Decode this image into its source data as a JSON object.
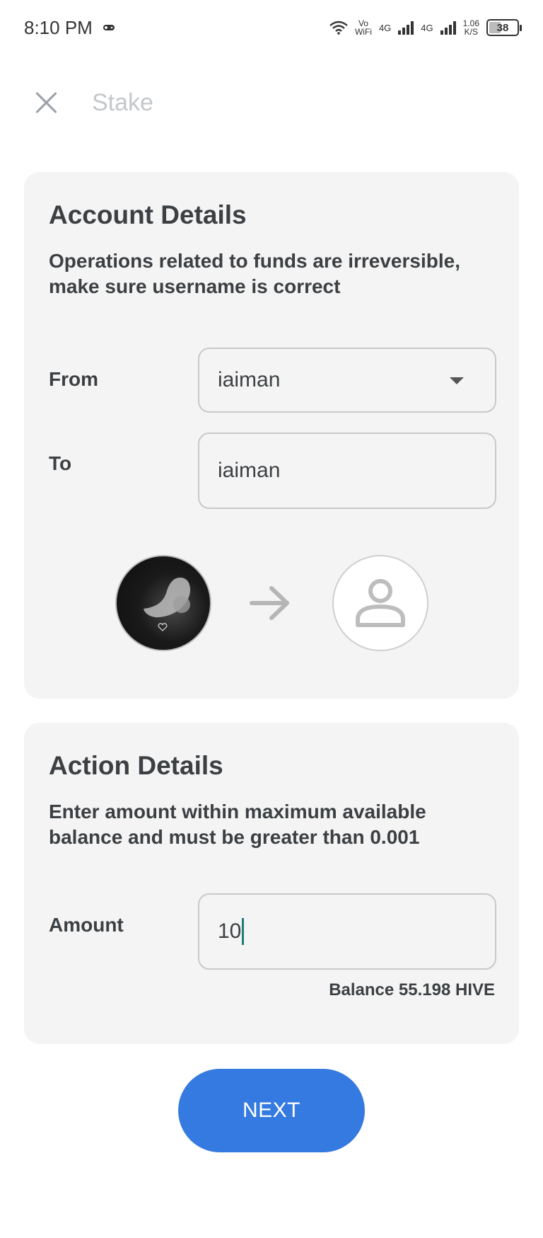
{
  "status_bar": {
    "time": "8:10 PM",
    "vowifi_top": "Vo",
    "vowifi_bottom": "WiFi",
    "network_1": "4G",
    "network_2": "4G",
    "speed_value": "1.06",
    "speed_unit": "K/S",
    "battery": "38"
  },
  "header": {
    "title": "Stake"
  },
  "account_details": {
    "title": "Account Details",
    "description": "Operations related to funds are irreversible, make sure username is correct",
    "from_label": "From",
    "from_value": "iaiman",
    "to_label": "To",
    "to_value": "iaiman"
  },
  "action_details": {
    "title": "Action Details",
    "description": "Enter amount within maximum available balance  and must be greater than 0.001",
    "amount_label": "Amount",
    "amount_value": "10",
    "balance_text": "Balance 55.198 HIVE"
  },
  "actions": {
    "next_label": "NEXT"
  },
  "colors": {
    "primary": "#357ae0",
    "card_bg": "#f4f4f4",
    "text": "#3c4043"
  }
}
